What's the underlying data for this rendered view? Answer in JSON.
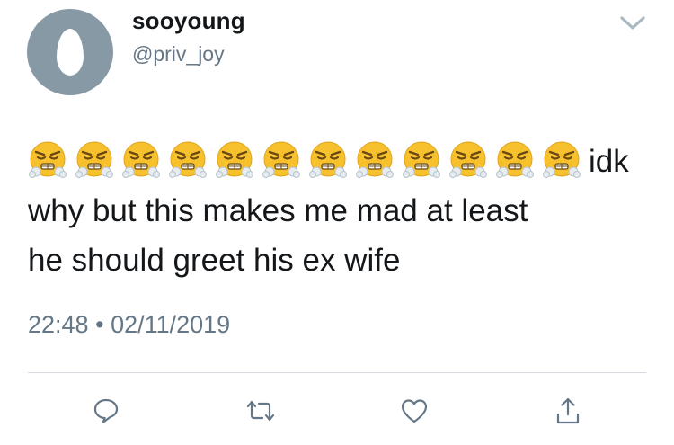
{
  "user": {
    "display_name": "sooyoung",
    "handle": "@priv_joy",
    "avatar_icon": "default-egg-avatar"
  },
  "tweet": {
    "emoji_name": "face-with-steam-from-nose",
    "emoji_count": 12,
    "text_line1": "idk",
    "text_line2": "why but this makes me mad at least",
    "text_line3": "he should greet his ex wife",
    "time": "22:48",
    "separator": "•",
    "date": "02/11/2019"
  },
  "actions": [
    {
      "name": "reply",
      "icon": "reply-icon"
    },
    {
      "name": "retweet",
      "icon": "retweet-icon"
    },
    {
      "name": "like",
      "icon": "heart-icon"
    },
    {
      "name": "share",
      "icon": "share-icon"
    }
  ],
  "colors": {
    "text": "#14171a",
    "secondary": "#657786",
    "avatar_bg": "#8899a6",
    "icon": "#657786",
    "emoji_face": "#f7c12d",
    "emoji_steam": "#e6ecf0"
  }
}
